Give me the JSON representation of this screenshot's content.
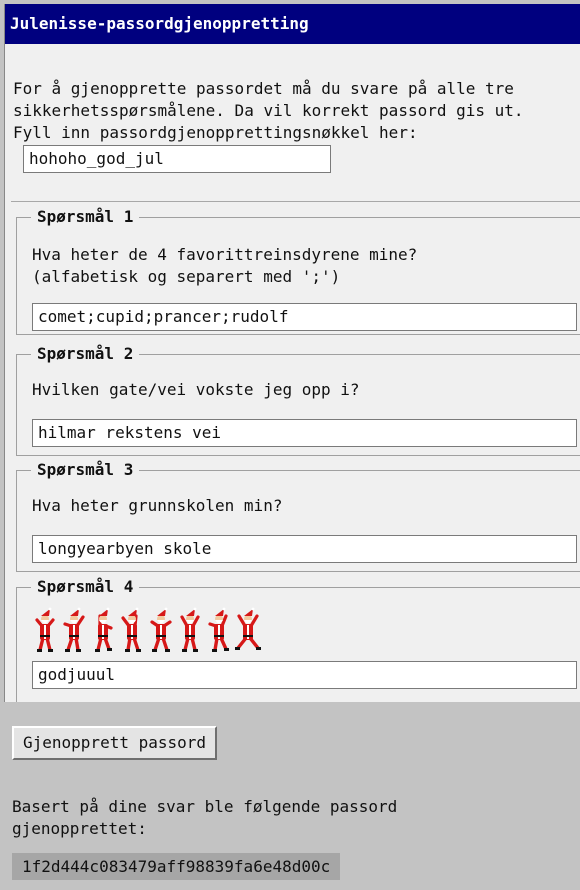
{
  "window": {
    "title": "Julenisse-passordgjenoppretting"
  },
  "intro": {
    "text": "For å gjenopprette passordet må du svare på alle tre\nsikkerhetsspørsmålene. Da vil korrekt passord gis ut.\nFyll inn passordgjenopprettingsnøkkel her:"
  },
  "recovery_key": {
    "value": "hohoho_god_jul"
  },
  "questions": [
    {
      "legend": "Spørsmål 1",
      "text": "Hva heter de 4 favorittreinsdyrene mine?\n(alfabetisk og separert med ';')",
      "answer": "comet;cupid;prancer;rudolf"
    },
    {
      "legend": "Spørsmål 2",
      "text": "Hvilken gate/vei vokste jeg opp i?",
      "answer": "hilmar rekstens vei"
    },
    {
      "legend": "Spørsmål 3",
      "text": "Hva heter grunnskolen min?",
      "answer": "longyearbyen skole"
    },
    {
      "legend": "Spørsmål 4",
      "image": "dancing-santas",
      "santa_count": 8,
      "answer": "godjuuul"
    }
  ],
  "actions": {
    "recover_button": "Gjenopprett passord"
  },
  "result": {
    "label": "Basert på dine svar ble følgende passord\ngjenopprettet:",
    "password": "1f2d444c083479aff98839fa6e48d00c"
  },
  "colors": {
    "titlebar": "#00007f",
    "window_bg": "#f0f0f0",
    "page_bg": "#c3c3c3",
    "santa_red": "#d61818",
    "password_bg": "#a6a6a6"
  }
}
